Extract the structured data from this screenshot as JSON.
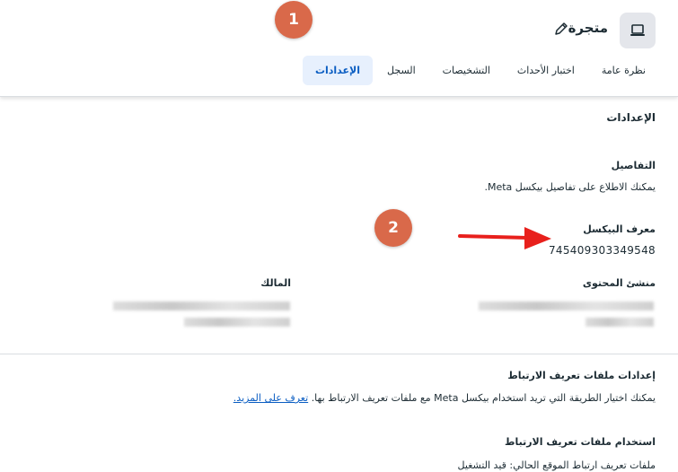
{
  "header": {
    "title": "متجرة",
    "tabs": [
      {
        "label": "نظرة عامة",
        "active": false
      },
      {
        "label": "اختبار الأحداث",
        "active": false
      },
      {
        "label": "التشخيصات",
        "active": false
      },
      {
        "label": "السجل",
        "active": false
      },
      {
        "label": "الإعدادات",
        "active": true
      }
    ]
  },
  "annotations": {
    "badge1": "1",
    "badge2": "2"
  },
  "settings": {
    "heading": "الإعدادات",
    "details_heading": "التفاصيل",
    "details_text": "يمكنك الاطلاع على تفاصيل بيكسل Meta.",
    "pixel_id_label": "معرف البيكسل",
    "pixel_id": "745409303349548",
    "content_creator_label": "منشئ المحتوى",
    "owner_label": "المالك",
    "cookie_settings_heading": "إعدادات ملفات تعريف الارتباط",
    "cookie_settings_text": "يمكنك اختيار الطريقة التي تريد استخدام بيكسل Meta مع ملفات تعريف الارتباط بها.",
    "learn_more": "تعرف على المزيد.",
    "cookie_usage_heading": "استخدام ملفات تعريف الارتباط",
    "cookie_usage_text": "ملفات تعريف ارتباط الموقع الحالي: قيد التشغيل"
  },
  "colors": {
    "badge": "#d9694a",
    "arrow": "#e8201c",
    "accent": "#0a5dc2"
  },
  "icons": {
    "asset": "laptop-icon",
    "edit": "pencil-icon"
  }
}
